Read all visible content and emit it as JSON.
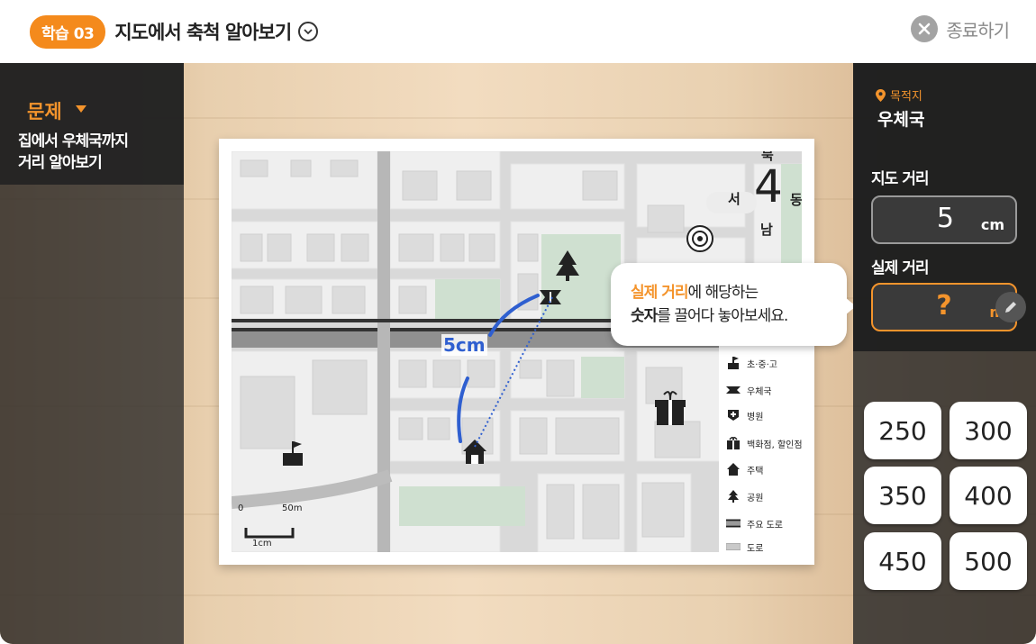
{
  "header": {
    "badge": "학습 03",
    "title": "지도에서 축척 알아보기",
    "close_label": "종료하기"
  },
  "problem": {
    "label": "문제",
    "text_line1": "집에서 우체국까지",
    "text_line2": "거리 알아보기"
  },
  "destination": {
    "label": "목적지",
    "value": "우체국"
  },
  "map_distance": {
    "label": "지도 거리",
    "value": "5",
    "unit": "cm"
  },
  "real_distance": {
    "label": "실제 거리",
    "value": "?",
    "unit": "m"
  },
  "answers": [
    "250",
    "300",
    "350",
    "400",
    "450",
    "500"
  ],
  "callout": {
    "hl1": "실제 거리",
    "part1": "에 해당하는",
    "b2": "숫자",
    "part2": "를 끌어다 놓아보세요."
  },
  "map": {
    "compass": {
      "north": "북",
      "south": "남",
      "west": "서",
      "east": "동",
      "glyph": "4"
    },
    "distance_label": "5cm",
    "scale": {
      "zero": "0",
      "max": "50m",
      "unit": "1cm"
    }
  },
  "legend": [
    {
      "icon": "school-icon",
      "label": "초·중·고"
    },
    {
      "icon": "post-office-icon",
      "label": "우체국"
    },
    {
      "icon": "hospital-icon",
      "label": "병원"
    },
    {
      "icon": "gift-icon",
      "label": "백화점, 할인점"
    },
    {
      "icon": "house-icon",
      "label": "주택"
    },
    {
      "icon": "tree-icon",
      "label": "공원"
    },
    {
      "icon": "main-road-icon",
      "label": "주요 도로"
    },
    {
      "icon": "road-icon",
      "label": "도로"
    }
  ],
  "colors": {
    "accent": "#f48a1c",
    "route_blue": "#2f5fd0",
    "panel_dark": "#2b2b2b"
  }
}
